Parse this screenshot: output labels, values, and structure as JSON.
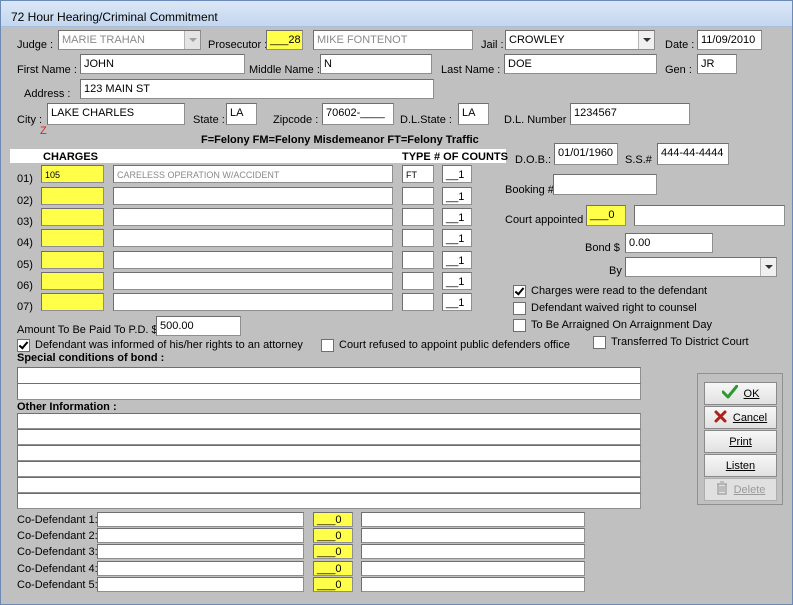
{
  "window": {
    "title": "72 Hour Hearing/Criminal Commitment"
  },
  "header": {
    "judge_label": "Judge :",
    "judge_value": "MARIE TRAHAN",
    "prosecutor_label": "Prosecutor :",
    "prosecutor_code": "___28",
    "prosecutor_name": "MIKE FONTENOT",
    "jail_label": "Jail :",
    "jail_value": "CROWLEY",
    "date_label": "Date :",
    "date_value": "11/09/2010"
  },
  "person": {
    "first_name_label": "First Name :",
    "first_name": "JOHN",
    "middle_name_label": "Middle Name :",
    "middle_name": "N",
    "last_name_label": "Last Name :",
    "last_name": "DOE",
    "gen_label": "Gen :",
    "gen": "JR",
    "address_label": "Address :",
    "address": "123 MAIN ST",
    "city_label": "City :",
    "city": "LAKE CHARLES",
    "city_marker": "Z",
    "state_label": "State :",
    "state": "LA",
    "zipcode_label": "Zipcode :",
    "zipcode": "70602-____",
    "dl_state_label": "D.L.State :",
    "dl_state": "LA",
    "dl_number_label": "D.L. Number :",
    "dl_number": "1234567",
    "dob_label": "D.O.B.:",
    "dob": "01/01/1960",
    "ss_label": "S.S.#",
    "ss": "444-44-4444"
  },
  "legend": "F=Felony  FM=Felony Misdemeanor  FT=Felony Traffic",
  "charges": {
    "header": "CHARGES",
    "type_header": "TYPE",
    "counts_header": "# OF COUNTS",
    "rows": [
      {
        "num": "01)",
        "code": "105",
        "desc": "CARELESS OPERATION W/ACCIDENT",
        "type": "FT",
        "count": "__1"
      },
      {
        "num": "02)",
        "code": "",
        "desc": "",
        "type": "",
        "count": "__1"
      },
      {
        "num": "03)",
        "code": "",
        "desc": "",
        "type": "",
        "count": "__1"
      },
      {
        "num": "04)",
        "code": "",
        "desc": "",
        "type": "",
        "count": "__1"
      },
      {
        "num": "05)",
        "code": "",
        "desc": "",
        "type": "",
        "count": "__1"
      },
      {
        "num": "06)",
        "code": "",
        "desc": "",
        "type": "",
        "count": "__1"
      },
      {
        "num": "07)",
        "code": "",
        "desc": "",
        "type": "",
        "count": "__1"
      }
    ]
  },
  "right": {
    "booking_label": "Booking #",
    "booking": "",
    "court_appointed_label": "Court appointed",
    "court_appointed_code": "___0",
    "court_appointed_name": "",
    "bond_label": "Bond $",
    "bond": "0.00",
    "by_label": "By",
    "by": "",
    "checks": [
      {
        "label": "Charges were read to the defendant",
        "checked": true
      },
      {
        "label": "Defendant waived right to counsel",
        "checked": false
      },
      {
        "label": "To Be Arraigned On Arraignment Day",
        "checked": false
      }
    ]
  },
  "payment": {
    "label": "Amount To Be Paid To P.D. $",
    "value": "500.00"
  },
  "options": [
    {
      "label": "Defendant was informed of his/her rights to an attorney",
      "checked": true
    },
    {
      "label": "Court refused to appoint public defenders office",
      "checked": false
    },
    {
      "label": "Transferred To District Court",
      "checked": false
    }
  ],
  "special": {
    "label": "Special conditions of bond :"
  },
  "other": {
    "label": "Other Information :"
  },
  "codefendants": [
    {
      "label": "Co-Defendant 1:",
      "code": "___0"
    },
    {
      "label": "Co-Defendant 2:",
      "code": "___0"
    },
    {
      "label": "Co-Defendant 3:",
      "code": "___0"
    },
    {
      "label": "Co-Defendant 4:",
      "code": "___0"
    },
    {
      "label": "Co-Defendant 5:",
      "code": "___0"
    }
  ],
  "buttons": {
    "ok": "OK",
    "cancel": "Cancel",
    "print": "Print",
    "listen": "Listen",
    "delete": "Delete"
  },
  "colors": {
    "required_field": "#ffff4a",
    "ok_icon": "#2e9a2e",
    "cancel_icon": "#b0201a",
    "city_marker": "#e02020"
  }
}
